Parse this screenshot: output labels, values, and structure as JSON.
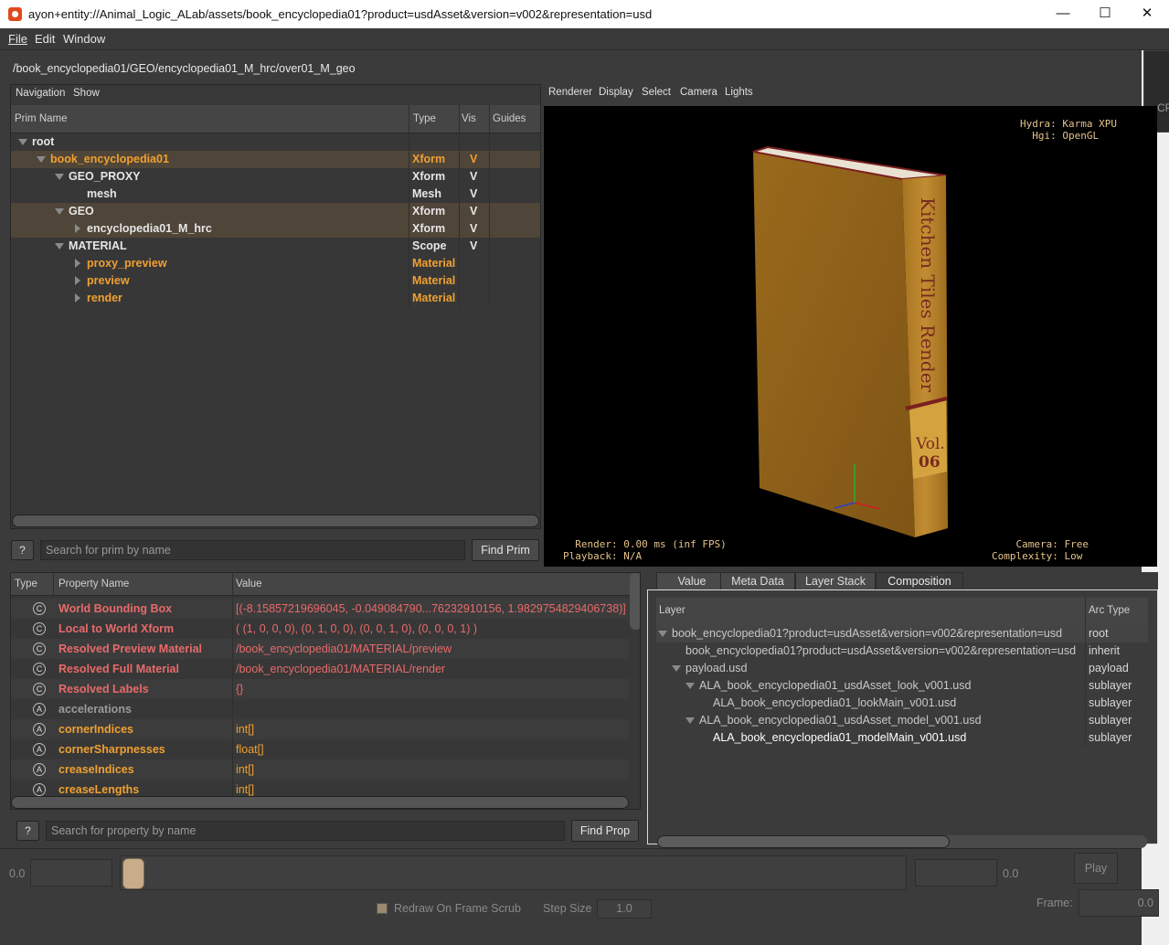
{
  "window": {
    "title": "ayon+entity://Animal_Logic_ALab/assets/book_encyclopedia01?product=usdAsset&version=v002&representation=usd",
    "minimize": "—",
    "maximize": "☐",
    "close": "✕"
  },
  "menu": {
    "file": "File",
    "edit": "Edit",
    "window": "Window"
  },
  "path": "/book_encyclopedia01/GEO/encyclopedia01_M_hrc/over01_M_geo",
  "side_widget_text": "CP",
  "tree": {
    "toolbar": {
      "navigation": "Navigation",
      "show": "Show"
    },
    "headers": {
      "name": "Prim Name",
      "type": "Type",
      "vis": "Vis",
      "guides": "Guides"
    },
    "rows": [
      {
        "name": "root",
        "type": "",
        "vis": "",
        "expander": "down",
        "color": "#e6e6e6",
        "highlight": false
      },
      {
        "name": "book_encyclopedia01",
        "type": "Xform",
        "vis": "V",
        "expander": "down",
        "color": "#f0a030",
        "highlight": true
      },
      {
        "name": "GEO_PROXY",
        "type": "Xform",
        "vis": "V",
        "expander": "down",
        "color": "#e6e6e6",
        "highlight": false
      },
      {
        "name": "mesh",
        "type": "Mesh",
        "vis": "V",
        "expander": "none",
        "color": "#e6e6e6",
        "highlight": false
      },
      {
        "name": "GEO",
        "type": "Xform",
        "vis": "V",
        "expander": "down",
        "color": "#e6e6e6",
        "highlight": true
      },
      {
        "name": "encyclopedia01_M_hrc",
        "type": "Xform",
        "vis": "V",
        "expander": "right",
        "color": "#e6e6e6",
        "highlight": true
      },
      {
        "name": "MATERIAL",
        "type": "Scope",
        "vis": "V",
        "expander": "down",
        "color": "#e6e6e6",
        "highlight": false
      },
      {
        "name": "proxy_preview",
        "type": "Material",
        "vis": "",
        "expander": "right",
        "color": "#f0a030",
        "highlight": false
      },
      {
        "name": "preview",
        "type": "Material",
        "vis": "",
        "expander": "right",
        "color": "#f0a030",
        "highlight": false
      },
      {
        "name": "render",
        "type": "Material",
        "vis": "",
        "expander": "right",
        "color": "#f0a030",
        "highlight": false
      }
    ],
    "help": "?",
    "search_placeholder": "Search for prim by name",
    "find": "Find Prim"
  },
  "viewport": {
    "menu": {
      "renderer": "Renderer",
      "display": "Display",
      "select": "Select",
      "camera": "Camera",
      "lights": "Lights"
    },
    "hud_top_right": "Hydra: Karma XPU\n  Hgi: OpenGL",
    "hud_bottom_left": "  Render: 0.00 ms (inf FPS)\nPlayback: N/A",
    "hud_bottom_right": "    Camera: Free\nComplexity: Low",
    "book_spine_text": "Kitchen Tiles Render",
    "book_vol": "Vol.",
    "book_num": "06"
  },
  "properties": {
    "headers": {
      "type": "Type",
      "name": "Property Name",
      "value": "Value"
    },
    "rows": [
      {
        "icon": "C",
        "name": "World Bounding Box",
        "value": "[(-8.15857219696045, -0.049084790...76232910156, 1.9829754829406738)]",
        "color": "#e86a6a"
      },
      {
        "icon": "C",
        "name": "Local to World Xform",
        "value": "( (1, 0, 0, 0), (0, 1, 0, 0), (0, 0, 1, 0), (0, 0, 0, 1) )",
        "color": "#e86a6a"
      },
      {
        "icon": "C",
        "name": "Resolved Preview Material",
        "value": "/book_encyclopedia01/MATERIAL/preview",
        "color": "#e86a6a"
      },
      {
        "icon": "C",
        "name": "Resolved Full Material",
        "value": "/book_encyclopedia01/MATERIAL/render",
        "color": "#e86a6a"
      },
      {
        "icon": "C",
        "name": "Resolved Labels",
        "value": "{}",
        "color": "#e86a6a"
      },
      {
        "icon": "A",
        "name": "accelerations",
        "value": "",
        "color": "#9a9a9a"
      },
      {
        "icon": "A",
        "name": "cornerIndices",
        "value": "int[]",
        "color": "#f0a030"
      },
      {
        "icon": "A",
        "name": "cornerSharpnesses",
        "value": "float[]",
        "color": "#f0a030"
      },
      {
        "icon": "A",
        "name": "creaseIndices",
        "value": "int[]",
        "color": "#f0a030"
      },
      {
        "icon": "A",
        "name": "creaseLengths",
        "value": "int[]",
        "color": "#f0a030"
      }
    ],
    "help": "?",
    "search_placeholder": "Search for property by name",
    "find": "Find Prop"
  },
  "composition": {
    "tabs": [
      "Value",
      "Meta Data",
      "Layer Stack",
      "Composition"
    ],
    "active_tab": "Composition",
    "headers": {
      "layer": "Layer",
      "arc": "Arc Type"
    },
    "rows": [
      {
        "layer": "book_encyclopedia01?product=usdAsset&version=v002&representation=usd",
        "arc": "root",
        "indent": 0,
        "expander": "down",
        "color": "#c8c8c8"
      },
      {
        "layer": "book_encyclopedia01?product=usdAsset&version=v002&representation=usd",
        "arc": "inherit",
        "indent": 1,
        "expander": "none",
        "color": "#c8c8c8"
      },
      {
        "layer": "payload.usd",
        "arc": "payload",
        "indent": 1,
        "expander": "down",
        "color": "#c8c8c8"
      },
      {
        "layer": "ALA_book_encyclopedia01_usdAsset_look_v001.usd",
        "arc": "sublayer",
        "indent": 2,
        "expander": "down",
        "color": "#c8c8c8"
      },
      {
        "layer": "ALA_book_encyclopedia01_lookMain_v001.usd",
        "arc": "sublayer",
        "indent": 3,
        "expander": "none",
        "color": "#c8c8c8"
      },
      {
        "layer": "ALA_book_encyclopedia01_usdAsset_model_v001.usd",
        "arc": "sublayer",
        "indent": 2,
        "expander": "down",
        "color": "#c8c8c8"
      },
      {
        "layer": "ALA_book_encyclopedia01_modelMain_v001.usd",
        "arc": "sublayer",
        "indent": 3,
        "expander": "none",
        "color": "#ffffff"
      }
    ]
  },
  "timeline": {
    "start": "0.0",
    "end": "0.0",
    "play": "Play",
    "redraw": "Redraw On Frame Scrub",
    "step_label": "Step Size",
    "step_value": "1.0",
    "frame_label": "Frame:",
    "frame_value": "0.0"
  }
}
